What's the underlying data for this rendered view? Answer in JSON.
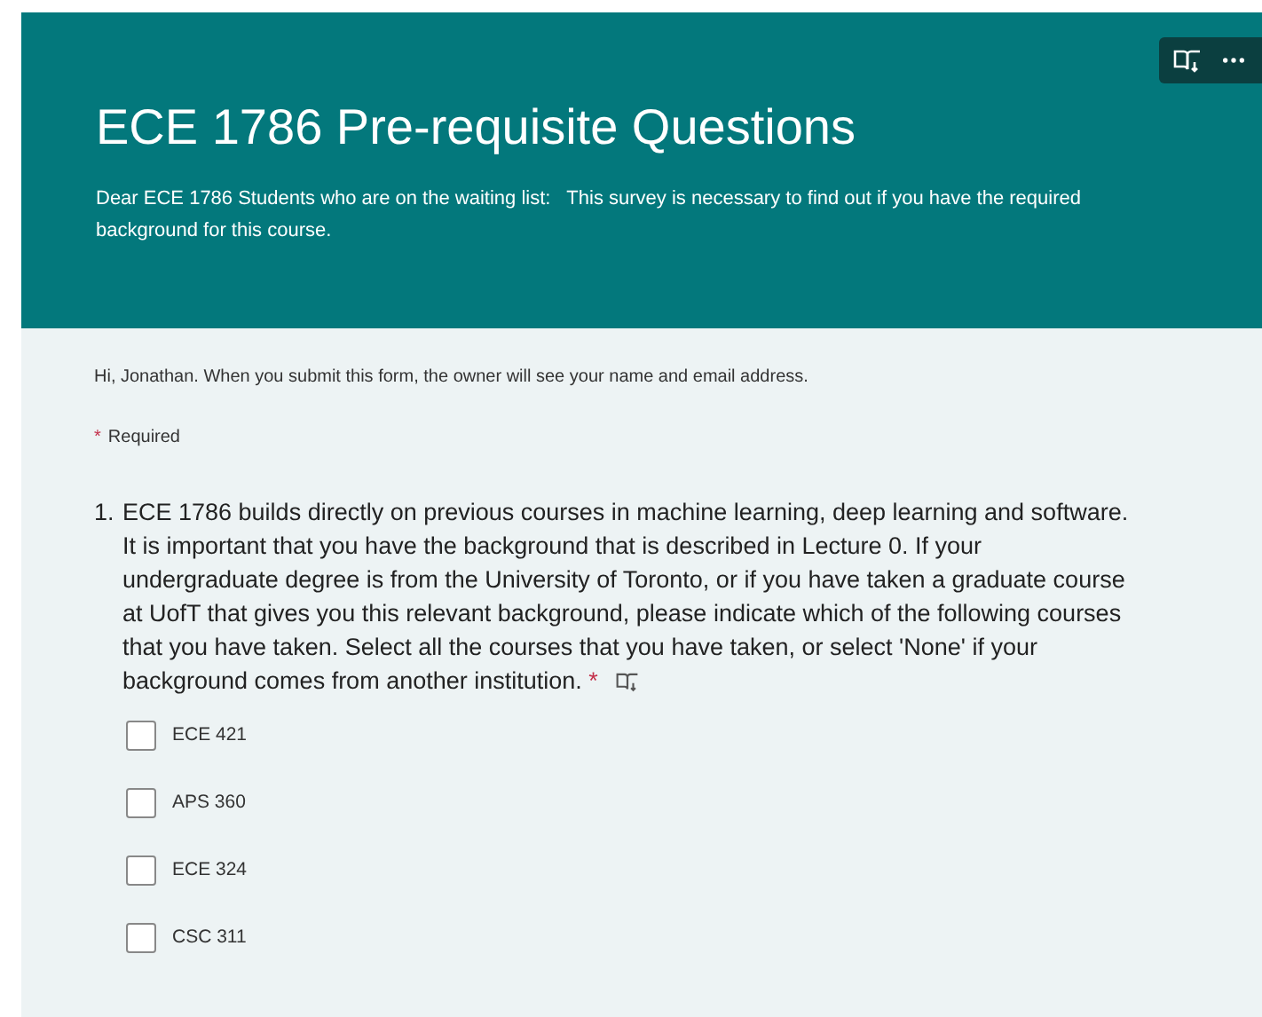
{
  "header": {
    "title": "ECE 1786 Pre-requisite Questions",
    "description": "Dear ECE 1786 Students who are on the waiting list:   This survey is necessary to find out if you have the required background for this course."
  },
  "notice": "Hi, Jonathan. When you submit this form, the owner will see your name and email address.",
  "required_note": {
    "mark": "*",
    "label": "Required"
  },
  "questions": [
    {
      "number": "1.",
      "text": "ECE 1786 builds directly on previous courses in machine learning, deep learning and software.  It is important that you have the background that is described in Lecture 0.  If your undergraduate degree is from the University of Toronto, or if you have taken a graduate course at UofT that gives you this relevant background, please indicate which of the following courses that you have taken.  Select all the courses that you have taken, or select 'None' if your background comes from another institution.",
      "required_mark": "*",
      "options": [
        {
          "label": "ECE 421",
          "checked": false
        },
        {
          "label": "APS 360",
          "checked": false
        },
        {
          "label": "ECE 324",
          "checked": false
        },
        {
          "label": "CSC 311",
          "checked": false
        }
      ]
    }
  ]
}
